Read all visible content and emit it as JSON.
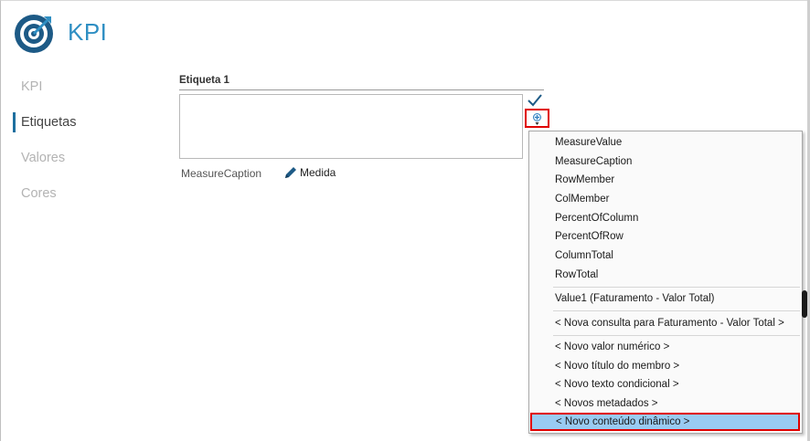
{
  "app": {
    "title": "KPI"
  },
  "nav": {
    "items": [
      {
        "label": "KPI",
        "active": false
      },
      {
        "label": "Etiquetas",
        "active": true
      },
      {
        "label": "Valores",
        "active": false
      },
      {
        "label": "Cores",
        "active": false
      }
    ]
  },
  "editor": {
    "field_label": "Etiqueta 1",
    "field_value": "",
    "hint_caption": "MeasureCaption",
    "hint_edit_label": "Medida"
  },
  "menu": {
    "group1": [
      "MeasureValue",
      "MeasureCaption",
      "RowMember",
      "ColMember",
      "PercentOfColumn",
      "PercentOfRow",
      "ColumnTotal",
      "RowTotal"
    ],
    "group2": [
      "Value1 (Faturamento - Valor Total)"
    ],
    "group3": [
      "< Nova consulta para Faturamento - Valor Total >"
    ],
    "group4": [
      "< Novo valor numérico >",
      "< Novo título do membro >",
      "< Novo texto condicional >",
      "< Novos metadados >",
      "< Novo conteúdo dinâmico >"
    ],
    "highlighted": "< Novo conteúdo dinâmico >"
  },
  "colors": {
    "accent": "#2f8fc3",
    "nav_active_bar": "#1d6f9f",
    "highlight": "#99cbf2",
    "annotation_red": "#e00000"
  }
}
